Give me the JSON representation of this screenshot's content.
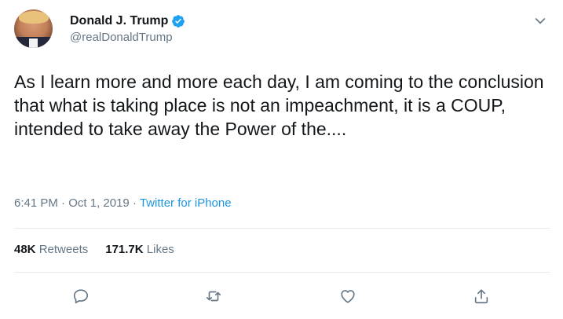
{
  "user": {
    "display_name": "Donald J. Trump",
    "handle": "@realDonaldTrump",
    "verified": true
  },
  "tweet": {
    "text": "As I learn more and more each day, I am coming to the conclusion that what is taking place is not an impeachment, it is a COUP, intended to take away the Power of the....",
    "time": "6:41 PM",
    "date": "Oct 1, 2019",
    "separator": "·",
    "source": "Twitter for iPhone"
  },
  "stats": {
    "retweets_count": "48K",
    "retweets_label": "Retweets",
    "likes_count": "171.7K",
    "likes_label": "Likes"
  },
  "actions": {
    "reply_icon": "reply-icon",
    "retweet_icon": "retweet-icon",
    "like_icon": "like-icon",
    "share_icon": "share-icon"
  },
  "colors": {
    "link": "#1b95e0",
    "muted": "#657786",
    "verified": "#1da1f2",
    "divider": "#e6ecf0"
  }
}
